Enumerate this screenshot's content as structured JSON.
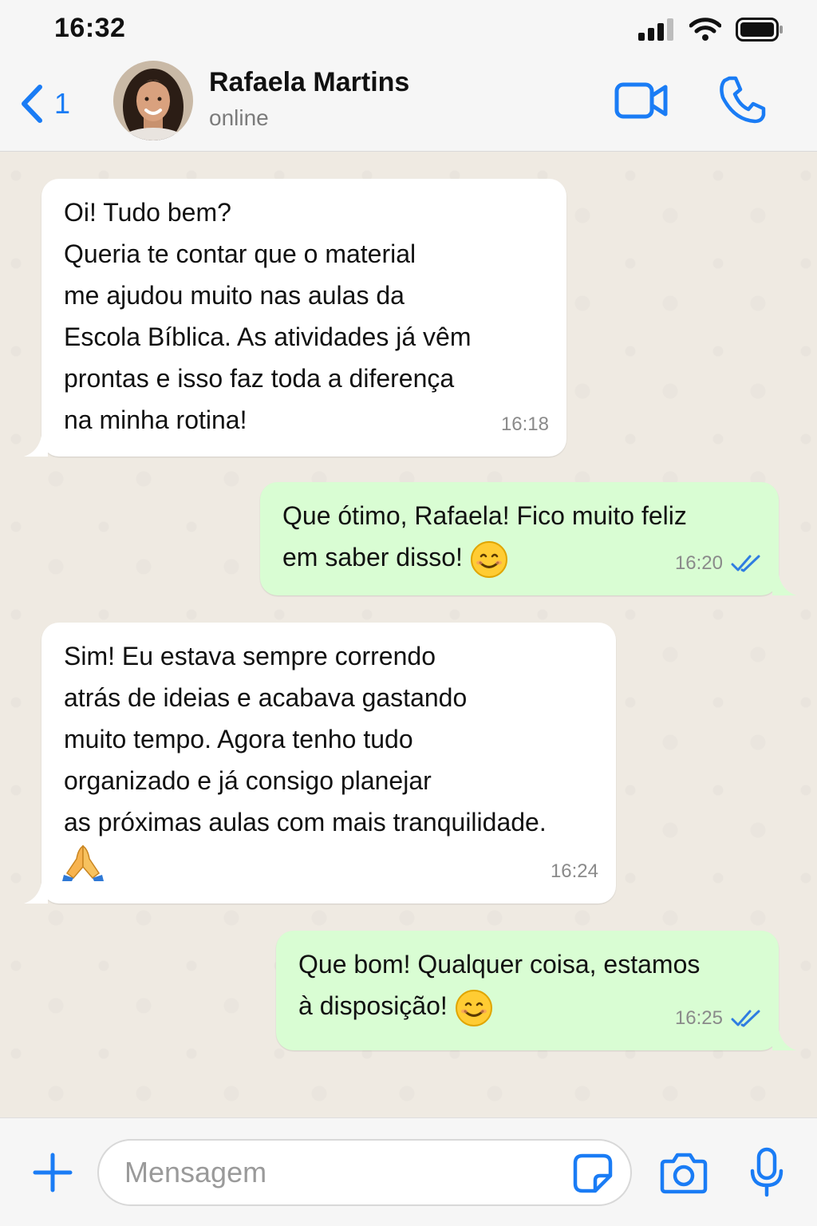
{
  "status_bar": {
    "time": "16:32"
  },
  "header": {
    "back_count": "1",
    "contact_name": "Rafaela Martins",
    "contact_status": "online"
  },
  "messages": [
    {
      "direction": "incoming",
      "text": "Oi! Tudo bem?\nQueria te contar que o material\nme ajudou muito nas aulas da\nEscola Bíblica. As atividades já vêm\nprontas e isso faz toda a diferença\nna minha rotina!",
      "time": "16:18"
    },
    {
      "direction": "outgoing",
      "text": "Que ótimo, Rafaela! Fico muito feliz\nem saber disso! ",
      "emoji": "smiling-face",
      "time": "16:20",
      "status": "read"
    },
    {
      "direction": "incoming",
      "text": "Sim! Eu estava sempre correndo\natrás de ideias e acabava gastando\nmuito tempo. Agora tenho tudo\norganizado e já consigo planejar\nas próximas aulas com mais tranquilidade.",
      "emoji": "folded-hands",
      "time": "16:24"
    },
    {
      "direction": "outgoing",
      "text": "Que bom! Qualquer coisa, estamos\nà disposição! ",
      "emoji": "smiling-face",
      "time": "16:25",
      "status": "read"
    }
  ],
  "input": {
    "placeholder": "Mensagem"
  },
  "colors": {
    "accent": "#1a7cf5",
    "incoming_bubble": "#ffffff",
    "outgoing_bubble": "#d9fdd3",
    "chat_background": "#efeae2",
    "read_ticks": "#2f7de1"
  }
}
